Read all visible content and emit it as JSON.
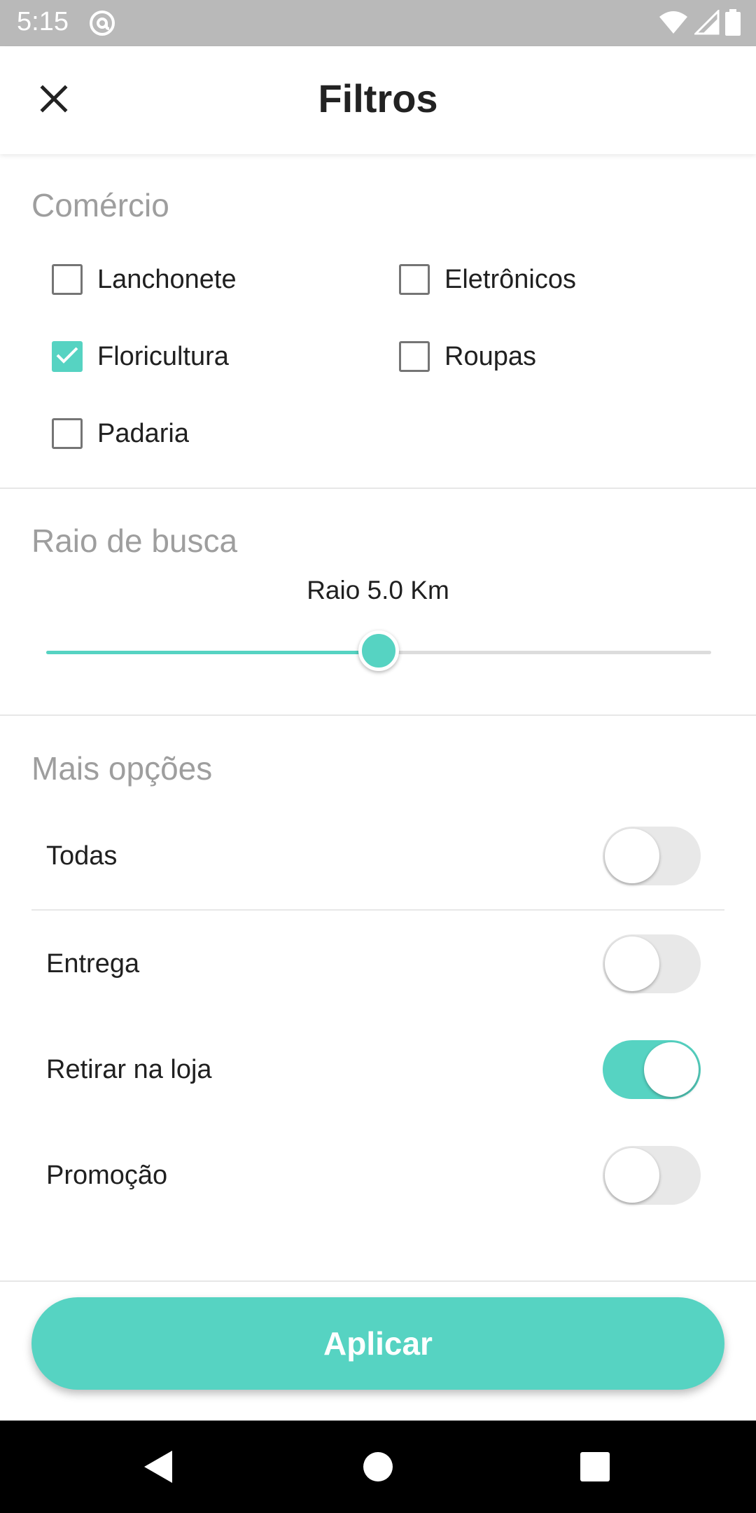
{
  "status_bar": {
    "time": "5:15",
    "icons": [
      "at-sign-icon",
      "wifi-icon",
      "signal-icon",
      "battery-icon"
    ]
  },
  "app_bar": {
    "title": "Filtros",
    "close_icon": "close-icon"
  },
  "comercio": {
    "title": "Comércio",
    "options": [
      {
        "label": "Lanchonete",
        "checked": false
      },
      {
        "label": "Eletrônicos",
        "checked": false
      },
      {
        "label": "Floricultura",
        "checked": true
      },
      {
        "label": "Roupas",
        "checked": false
      },
      {
        "label": "Padaria",
        "checked": false
      }
    ]
  },
  "raio": {
    "title": "Raio de busca",
    "label": "Raio 5.0 Km",
    "value_fraction": 0.5
  },
  "mais_opcoes": {
    "title": "Mais opções",
    "options": [
      {
        "label": "Todas",
        "on": false
      },
      {
        "label": "Entrega",
        "on": false
      },
      {
        "label": "Retirar na loja",
        "on": true
      },
      {
        "label": "Promoção",
        "on": false
      }
    ]
  },
  "apply_label": "Aplicar",
  "colors": {
    "accent": "#56d3c2",
    "status_bar": "#b9b9b9",
    "section_title": "#9e9e9e"
  },
  "nav_bar": [
    "back-icon",
    "home-icon",
    "recents-icon"
  ]
}
